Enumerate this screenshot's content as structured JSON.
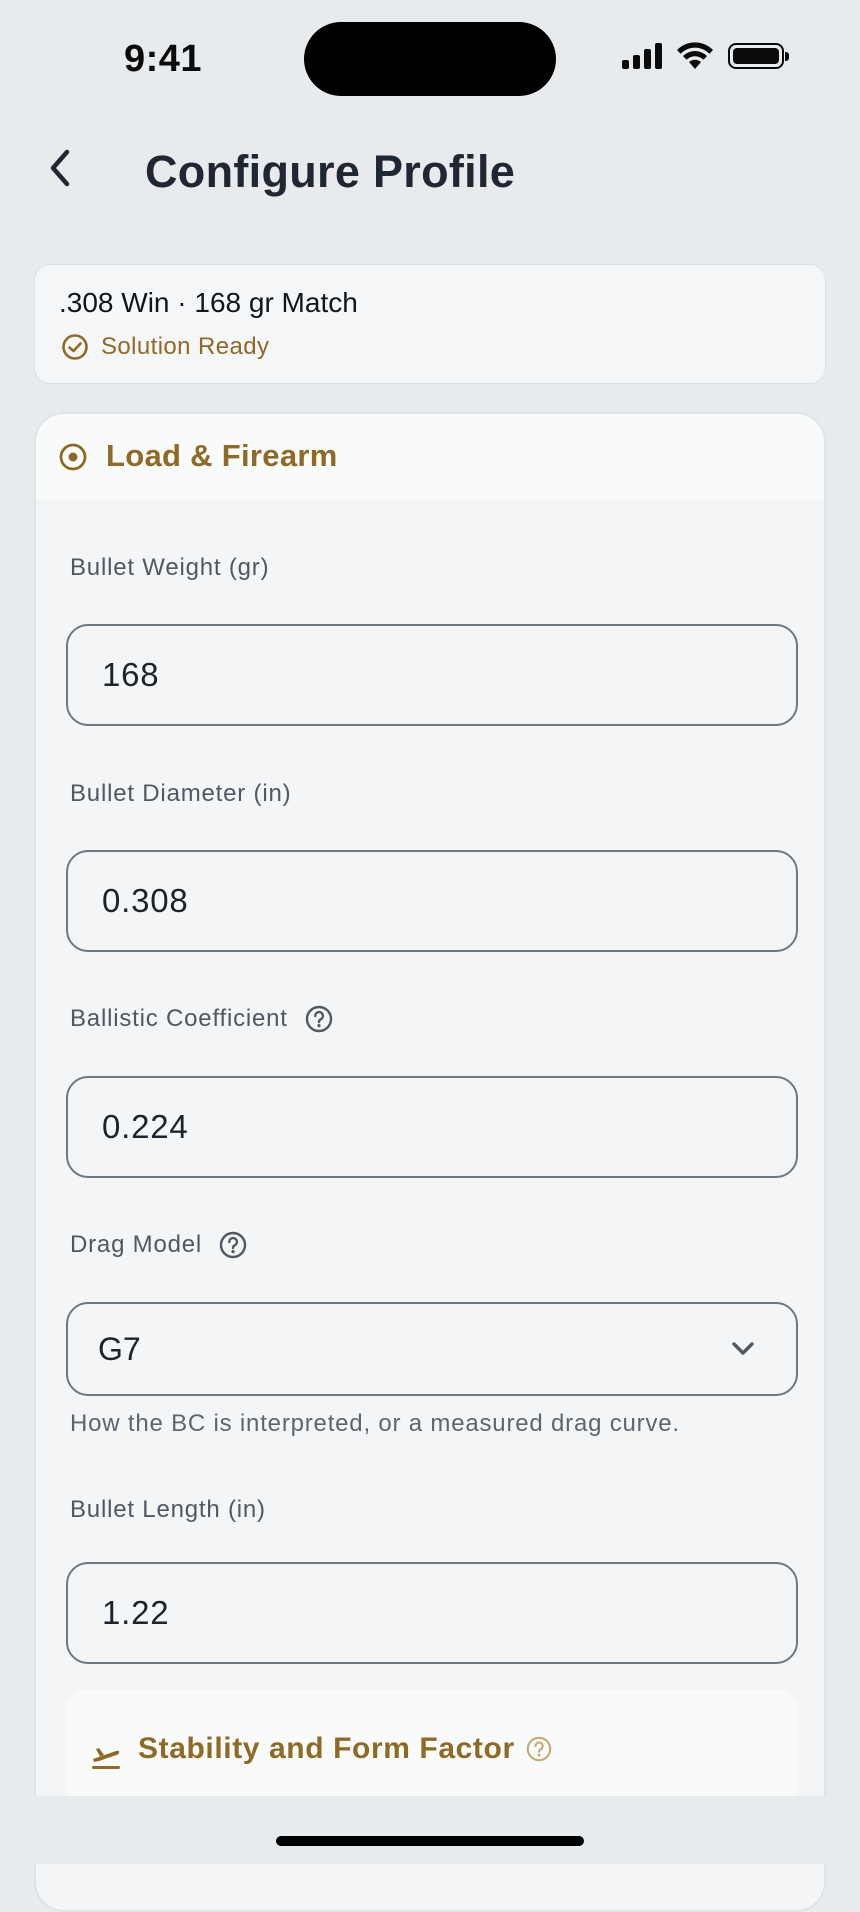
{
  "status_bar": {
    "time": "9:41"
  },
  "header": {
    "back_icon": "chevron-left-icon",
    "title": "Configure Profile"
  },
  "profile_summary": {
    "name": ".308 Win · 168 gr Match",
    "status_icon": "check-circle-icon",
    "status": "Solution Ready"
  },
  "section": {
    "icon": "target-icon",
    "title": "Load & Firearm",
    "fields": {
      "bullet_weight": {
        "label": "Bullet Weight (gr)",
        "value": "168"
      },
      "bullet_diameter": {
        "label": "Bullet Diameter (in)",
        "value": "0.308"
      },
      "ballistic_coefficient": {
        "label": "Ballistic Coefficient",
        "value": "0.224",
        "help_icon": "help-circle-icon"
      },
      "drag_model": {
        "label": "Drag Model",
        "value": "G7",
        "help_icon": "help-circle-icon",
        "helper": "How the BC is interpreted, or a measured drag curve."
      },
      "bullet_length": {
        "label": "Bullet Length (in)",
        "value": "1.22"
      }
    },
    "subsection": {
      "icon": "takeoff-icon",
      "title": "Stability and Form Factor",
      "help_icon": "help-circle-icon"
    }
  },
  "colors": {
    "accent": "#8f6a25",
    "background": "#e8ebee",
    "card": "#f3f5f7",
    "text": "#1f2733",
    "input_border": "#6e7883"
  }
}
